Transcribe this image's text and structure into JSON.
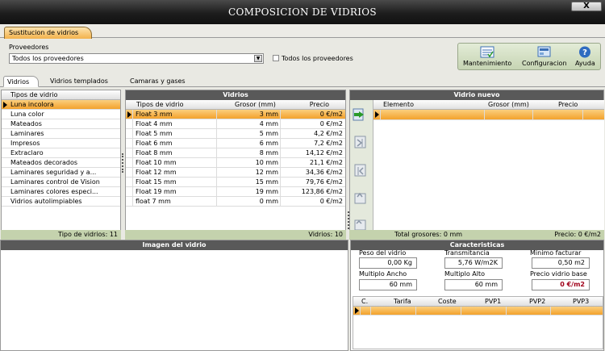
{
  "window": {
    "title": "COMPOSICION DE VIDRIOS",
    "close_label": "X"
  },
  "main_tab": "Sustitucion de vidrios",
  "providers": {
    "label": "Proveedores",
    "selected": "Todos los proveedores",
    "checkbox_label": "Todos los proveedores"
  },
  "toolbar": {
    "mantenimiento": "Mantenimiento",
    "configuracion": "Configuracion",
    "ayuda": "Ayuda"
  },
  "sub_tabs": [
    "Vidrios",
    "Vidrios templados",
    "Camaras y gases"
  ],
  "types_panel": {
    "header": "Tipos de vidrio",
    "items": [
      "Luna incolora",
      "Luna color",
      "Mateados",
      "Laminares",
      "Impresos",
      "Extraclaro",
      "Mateados decorados",
      "Laminares seguridad y a...",
      "Laminares control de Vision",
      "Laminares colores especi...",
      "Vidrios autolimpiables"
    ],
    "selected_index": 0,
    "footer": "Tipo de vidrios: 11"
  },
  "vidrios_panel": {
    "title": "Vidrios",
    "columns": [
      "Tipos de vidrio",
      "Grosor (mm)",
      "Precio"
    ],
    "rows": [
      [
        "Float 3 mm",
        "3 mm",
        "0 €/m2"
      ],
      [
        "Float 4 mm",
        "4 mm",
        "0 €/m2"
      ],
      [
        "Float 5 mm",
        "5 mm",
        "4,2 €/m2"
      ],
      [
        "Float 6 mm",
        "6 mm",
        "7,2 €/m2"
      ],
      [
        "Float 8 mm",
        "8 mm",
        "14,12 €/m2"
      ],
      [
        "Float 10 mm",
        "10 mm",
        "21,1 €/m2"
      ],
      [
        "Float 12 mm",
        "12 mm",
        "34,36 €/m2"
      ],
      [
        "Float 15 mm",
        "15 mm",
        "79,76 €/m2"
      ],
      [
        "Float 19 mm",
        "19 mm",
        "123,86 €/m2"
      ],
      [
        "float 7 mm",
        "0 mm",
        "0 €/m2"
      ]
    ],
    "selected_index": 0,
    "footer": "Vidrios: 10"
  },
  "nuevo_panel": {
    "title": "Vidrio nuevo",
    "columns": [
      "Elemento",
      "Grosor (mm)",
      "Precio"
    ],
    "footer_left": "Total grosores: 0 mm",
    "footer_right": "Precio: 0 €/m2"
  },
  "image_panel": {
    "title": "Imagen del vidrio"
  },
  "caracteristicas": {
    "title": "Caracteristicas",
    "fields": {
      "peso_label": "Peso del vidrio",
      "peso_value": "0,00 Kg",
      "trans_label": "Transmitancia",
      "trans_value": "5,76 W/m2K",
      "minimo_label": "Minimo facturar",
      "minimo_value": "0,50 m2",
      "ancho_label": "Multiplo Ancho",
      "ancho_value": "60 mm",
      "alto_label": "Multiplo Alto",
      "alto_value": "60 mm",
      "base_label": "Precio vidrio base",
      "base_value": "0 €/m2"
    },
    "table_columns": [
      "C.",
      "Tarifa",
      "Coste",
      "PVP1",
      "PVP2",
      "PVP3"
    ]
  },
  "colors": {
    "selection": "#f3a22c",
    "header_dark": "#595959",
    "footer_green": "#c4d2ad",
    "price_red": "#a0001a"
  }
}
